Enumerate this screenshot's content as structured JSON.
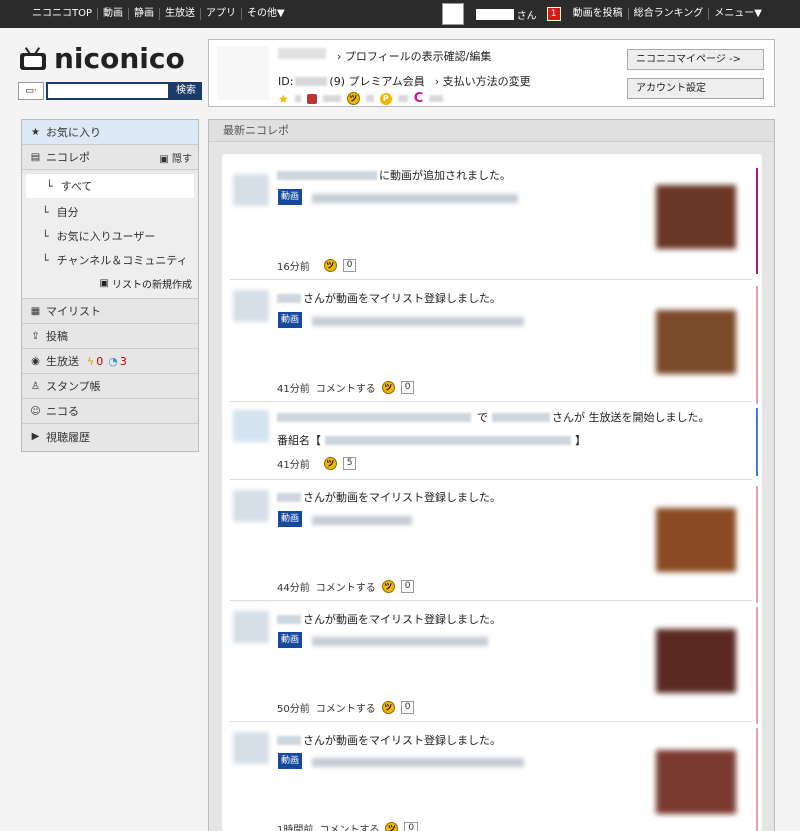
{
  "topbar": {
    "nav": [
      "ニコニコTOP",
      "動画",
      "静画",
      "生放送",
      "アプリ",
      "その他▼"
    ],
    "user_suffix": "さん",
    "notification_count": "1",
    "links": [
      "動画を投稿",
      "総合ランキング",
      "メニュー▼"
    ]
  },
  "logo": {
    "text": "niconico"
  },
  "search": {
    "type_label": "▭·",
    "button": "検索",
    "placeholder": ""
  },
  "profile": {
    "edit_link": "プロフィールの表示確認/編集",
    "id_label": "ID:",
    "member": "(9) プレミアム会員",
    "payment_link": "支払い方法の変更",
    "mypage_button": "ニコニコマイページ ->",
    "account_button": "アカウント設定"
  },
  "sidebar": {
    "favorites": "お気に入り",
    "nicorepo": "ニコレポ",
    "hide": "隠す",
    "subs": [
      "すべて",
      "自分",
      "お気に入りユーザー",
      "チャンネル＆コミュニティ"
    ],
    "new_list": "リストの新規作成",
    "mylist": "マイリスト",
    "post": "投稿",
    "live": "生放送",
    "live_count_a": "0",
    "live_count_b": "3",
    "stamp": "スタンプ帳",
    "nicoru": "ニコる",
    "history": "視聴履歴"
  },
  "main": {
    "header": "最新ニコレポ"
  },
  "feed": [
    {
      "text": "に動画が追加されました。",
      "badge": "動画",
      "time": "16分前",
      "comment": "",
      "count": "0",
      "bar": "#a0206a"
    },
    {
      "text": "さんが動画をマイリスト登録しました。",
      "badge": "動画",
      "time": "41分前",
      "comment": "コメントする",
      "count": "0",
      "bar": "#e8a0a0"
    },
    {
      "text_a": "で",
      "text_b": "さんが 生放送を開始しました。",
      "program_label": "番組名【",
      "program_end": "】",
      "time": "41分前",
      "count": "5",
      "bar": "#3b7fd4"
    },
    {
      "text": "さんが動画をマイリスト登録しました。",
      "badge": "動画",
      "time": "44分前",
      "comment": "コメントする",
      "count": "0",
      "bar": "#e8a0a0"
    },
    {
      "text": "さんが動画をマイリスト登録しました。",
      "badge": "動画",
      "time": "50分前",
      "comment": "コメントする",
      "count": "0",
      "bar": "#e8a0a0"
    },
    {
      "text": "さんが動画をマイリスト登録しました。",
      "badge": "動画",
      "time": "1時間前",
      "comment": "コメントする",
      "count": "0",
      "bar": "#e8a0a0"
    }
  ]
}
